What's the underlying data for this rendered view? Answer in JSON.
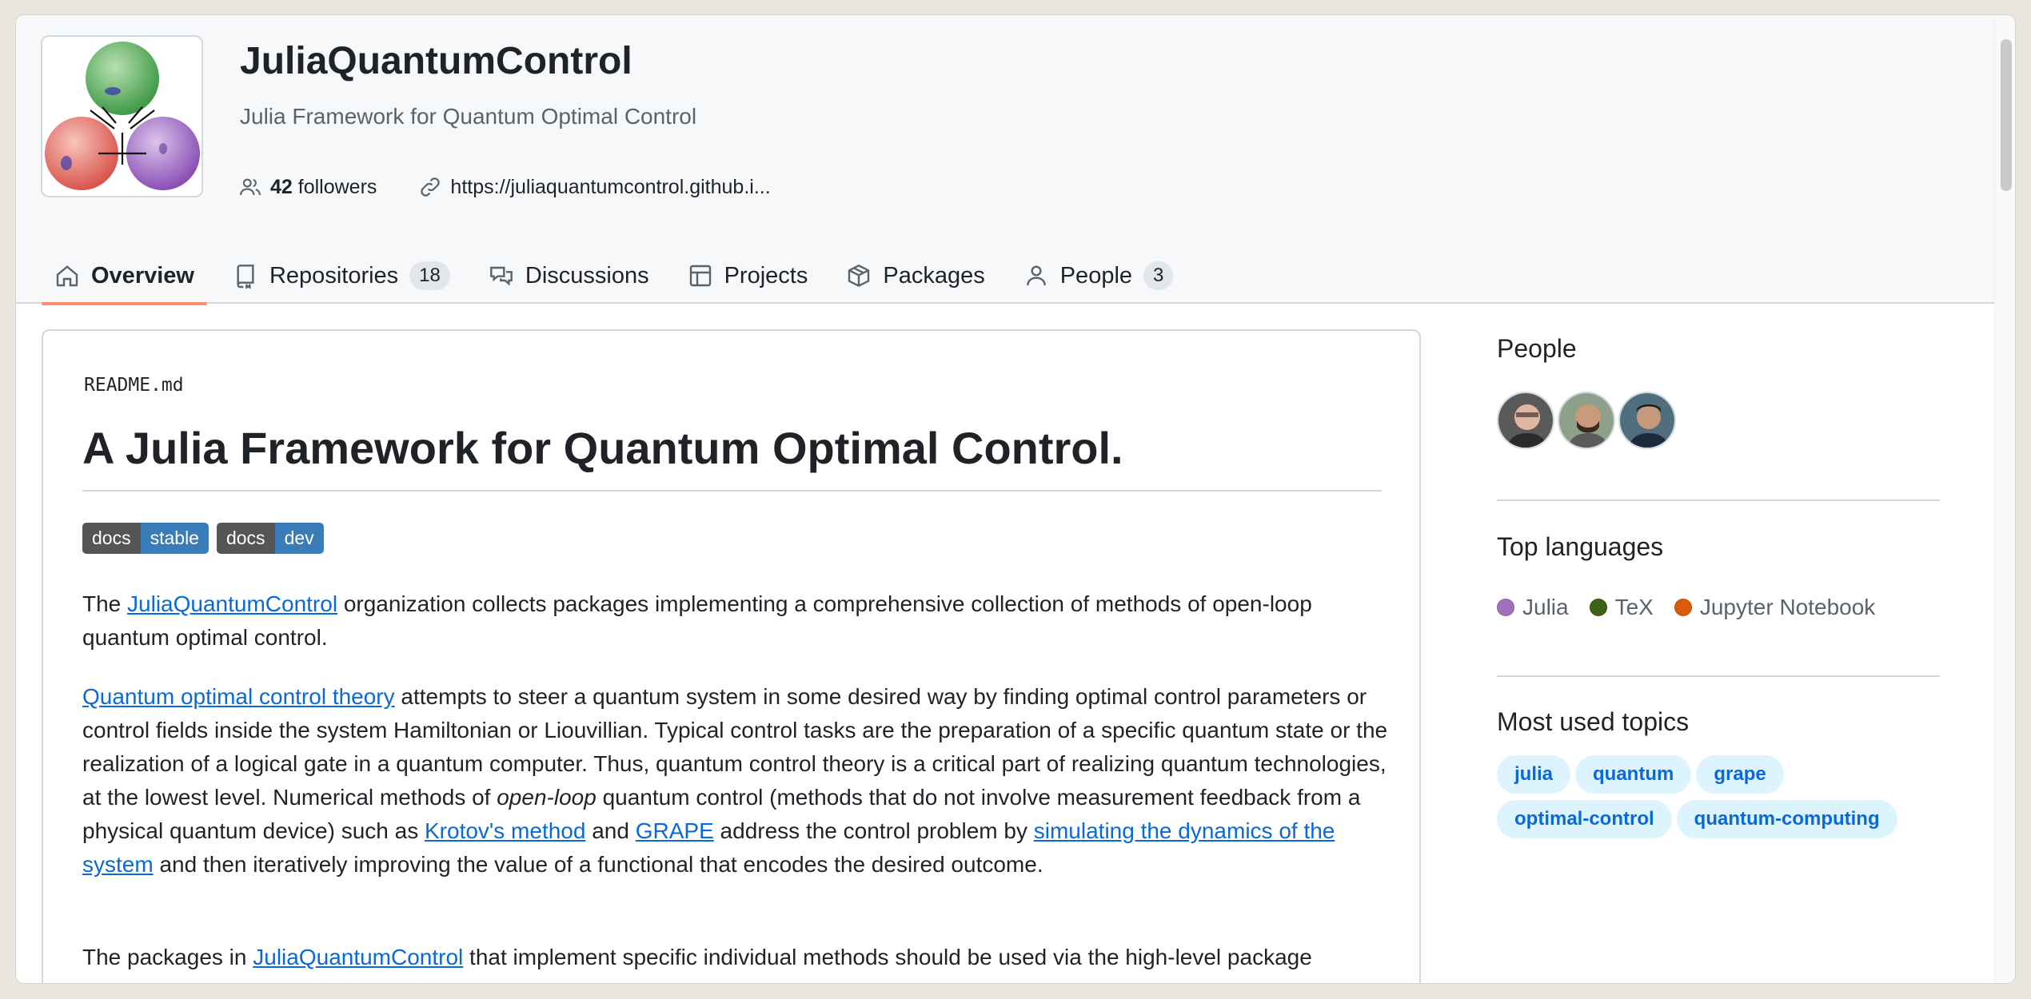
{
  "org": {
    "name": "JuliaQuantumControl",
    "description": "Julia Framework for Quantum Optimal Control",
    "followers_count": "42",
    "followers_label": "followers",
    "url": "https://juliaquantumcontrol.github.i..."
  },
  "tabs": [
    {
      "label": "Overview",
      "icon": "home-icon",
      "active": true
    },
    {
      "label": "Repositories",
      "icon": "repo-icon",
      "count": "18"
    },
    {
      "label": "Discussions",
      "icon": "discussions-icon"
    },
    {
      "label": "Projects",
      "icon": "table-icon"
    },
    {
      "label": "Packages",
      "icon": "package-icon"
    },
    {
      "label": "People",
      "icon": "person-icon",
      "count": "3"
    }
  ],
  "readme": {
    "filename": "README.md",
    "heading": "A Julia Framework for Quantum Optimal Control.",
    "badges": [
      {
        "left": "docs",
        "right": "stable"
      },
      {
        "left": "docs",
        "right": "dev"
      }
    ],
    "p1": {
      "t1": "The ",
      "link1": "JuliaQuantumControl",
      "t2": " organization collects packages implementing a comprehensive collection of methods of open-loop quantum optimal control."
    },
    "p2": {
      "link1": "Quantum optimal control theory",
      "t1": " attempts to steer a quantum system in some desired way by finding optimal control parameters or control fields inside the system Hamiltonian or Liouvillian. Typical control tasks are the preparation of a specific quantum state or the realization of a logical gate in a quantum computer. Thus, quantum control theory is a critical part of realizing quantum technologies, at the lowest level. Numerical methods of ",
      "em": "open-loop",
      "t2": " quantum control (methods that do not involve measurement feedback from a physical quantum device) such as ",
      "link2": "Krotov's method",
      "t3": " and ",
      "link3": "GRAPE",
      "t4": " address the control problem by ",
      "link4": "simulating the dynamics of the system",
      "t5": " and then iteratively improving the value of a functional that encodes the desired outcome."
    },
    "p3": {
      "t1": "The packages in ",
      "link1": "JuliaQuantumControl",
      "t2": " that implement specific individual methods should be used via the high-level package"
    }
  },
  "sidebar": {
    "people_heading": "People",
    "languages_heading": "Top languages",
    "languages": [
      {
        "name": "Julia",
        "color": "#a270ba"
      },
      {
        "name": "TeX",
        "color": "#3d6117"
      },
      {
        "name": "Jupyter Notebook",
        "color": "#da5b0b"
      }
    ],
    "topics_heading": "Most used topics",
    "topics": [
      "julia",
      "quantum",
      "grape",
      "optimal-control",
      "quantum-computing"
    ]
  },
  "colors": {
    "accent_link": "#0969da",
    "tab_underline": "#fd8c73",
    "badge_blue": "#3a7cb8"
  }
}
